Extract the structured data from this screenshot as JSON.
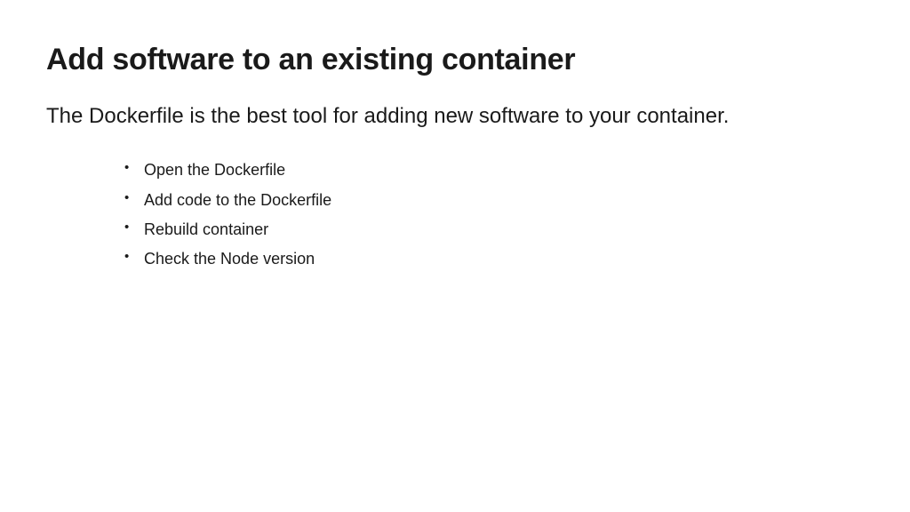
{
  "title": "Add software to an existing container",
  "subtitle": "The Dockerfile is the best tool for adding new software to your container.",
  "bullets": {
    "0": "Open the Dockerfile",
    "1": "Add code to the Dockerfile",
    "2": "Rebuild container",
    "3": "Check the Node version"
  }
}
